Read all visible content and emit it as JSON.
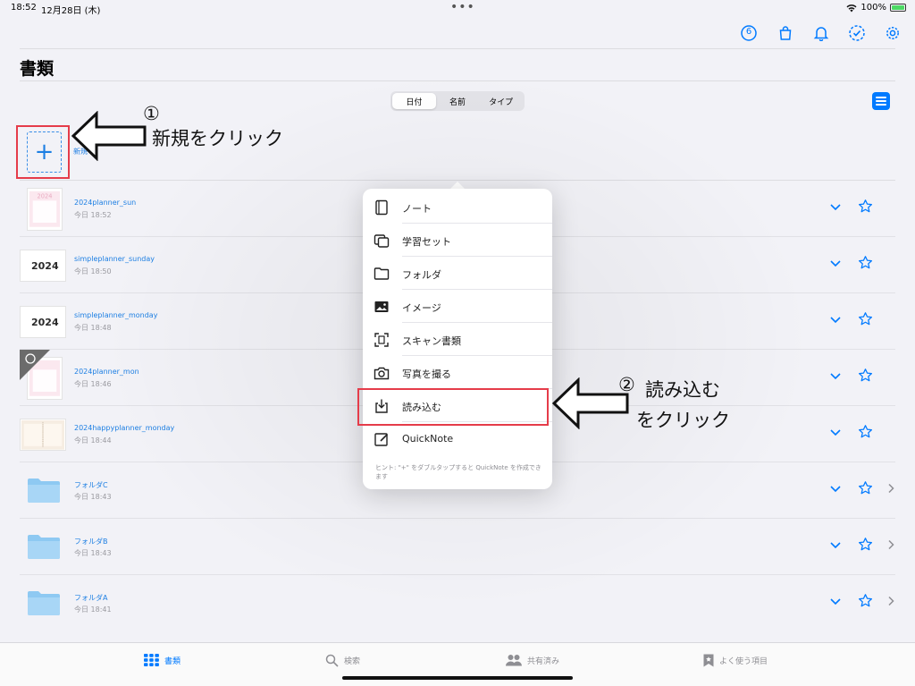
{
  "status": {
    "time": "18:52",
    "date": "12月28日 (木)",
    "battery": "100%"
  },
  "header": {
    "title": "書類",
    "badge_count": "6"
  },
  "sort": {
    "tabs": [
      "日付",
      "名前",
      "タイプ"
    ]
  },
  "new_item": {
    "label": "新規"
  },
  "documents": [
    {
      "name": "2024planner_sun",
      "date": "今日 18:52"
    },
    {
      "name": "simpleplanner_sunday",
      "date": "今日 18:50",
      "cover": "2024"
    },
    {
      "name": "simpleplanner_monday",
      "date": "今日 18:48",
      "cover": "2024"
    },
    {
      "name": "2024planner_mon",
      "date": "今日 18:46"
    },
    {
      "name": "2024happyplanner_monday",
      "date": "今日 18:44"
    },
    {
      "name": "フォルダC",
      "date": "今日 18:43"
    },
    {
      "name": "フォルダB",
      "date": "今日 18:43"
    },
    {
      "name": "フォルダA",
      "date": "今日 18:41"
    }
  ],
  "menu": {
    "items": [
      "ノート",
      "学習セット",
      "フォルダ",
      "イメージ",
      "スキャン書類",
      "写真を撮る",
      "読み込む",
      "QuickNote"
    ],
    "hint": "ヒント: \"+\" をダブルタップすると QuickNote を作成できます"
  },
  "annotations": {
    "step1_number": "①",
    "step1_text": "新規をクリック",
    "step2_number": "②",
    "step2_text_line1": "読み込む",
    "step2_text_line2": "をクリック"
  },
  "tabbar": {
    "tabs": [
      "書類",
      "検索",
      "共有済み",
      "よく使う項目"
    ]
  },
  "colors": {
    "accent": "#007aff",
    "highlight_border": "#e53c4a"
  }
}
